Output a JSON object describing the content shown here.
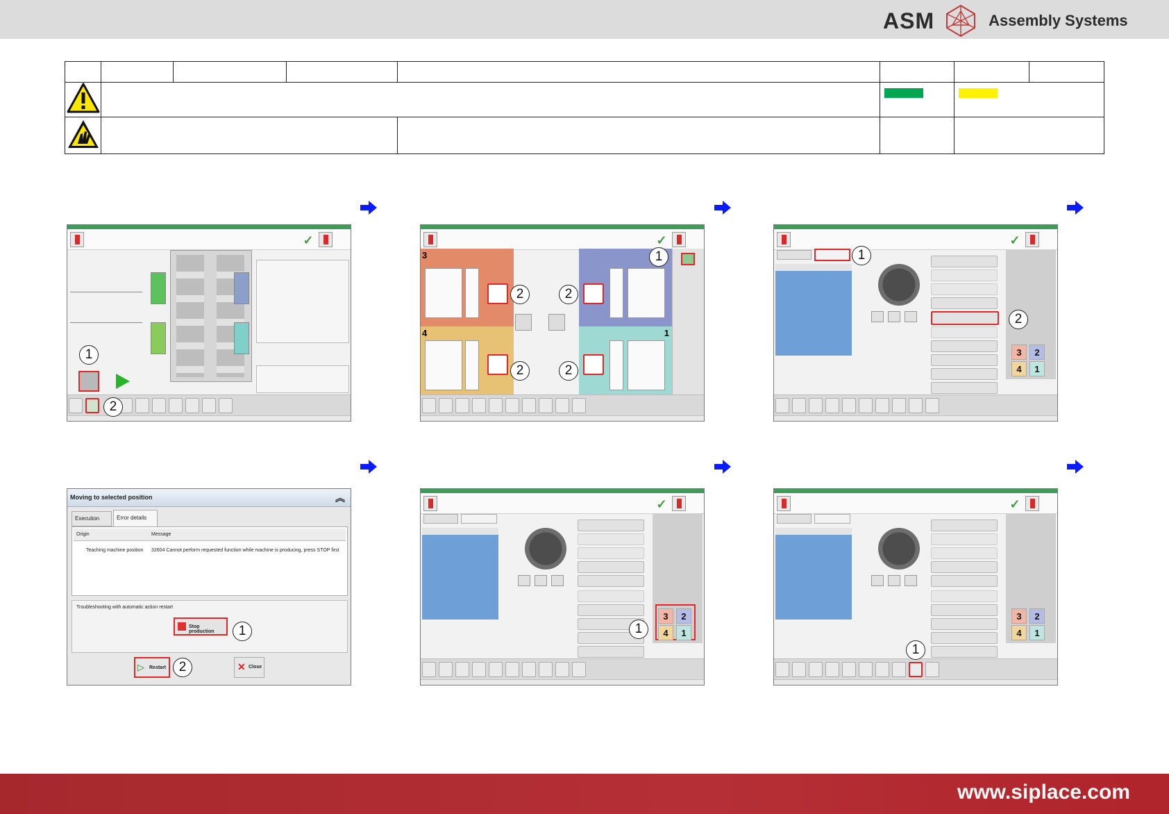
{
  "header": {
    "brand_short": "ASM",
    "brand_tagline": "Assembly Systems"
  },
  "colors": {
    "info_green": "#00a651",
    "info_yellow": "#fff200",
    "arrow_blue": "#0a1cff",
    "footer_red": "#b0282e",
    "callout_red": "#e32626"
  },
  "icons": {
    "warning": "warning-triangle-icon",
    "esd": "esd-hand-icon"
  },
  "screens": {
    "s1": {
      "callouts": [
        "1",
        "2"
      ]
    },
    "s2": {
      "quadrants": [
        "3",
        "4",
        "1"
      ],
      "callouts": [
        "1",
        "2",
        "2",
        "2",
        "2"
      ]
    },
    "s3": {
      "callouts": [
        "1",
        "2"
      ],
      "head_numbers": [
        "3",
        "2",
        "4",
        "1"
      ]
    },
    "s4": {
      "dialog_title": "Moving to selected position",
      "tab_execution": "Execution",
      "tab_error_details": "Error details",
      "col_origin": "Origin",
      "col_message": "Message",
      "row_origin": "Teaching machine position",
      "row_message": "32604 Cannot perform requested function while machine is producing, press STOP first",
      "troubleshooting": "Troubleshooting with automatic action restart",
      "stop_button": "Stop production",
      "restart_button": "Restart",
      "close_button": "Close",
      "callouts": [
        "1",
        "2"
      ]
    },
    "s5": {
      "callouts": [
        "1"
      ],
      "head_numbers": [
        "3",
        "2",
        "4",
        "1"
      ]
    },
    "s6": {
      "callouts": [
        "1"
      ],
      "head_numbers": [
        "3",
        "2",
        "4",
        "1"
      ]
    }
  },
  "footer": {
    "url": "www.siplace.com"
  }
}
